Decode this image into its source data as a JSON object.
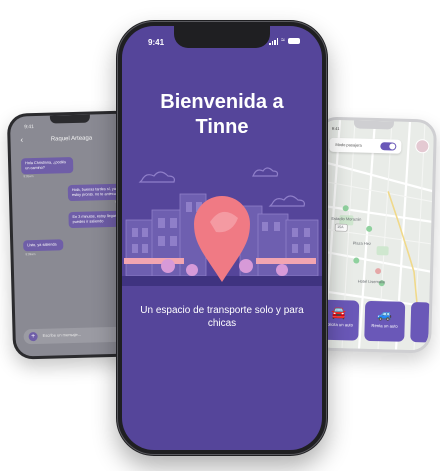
{
  "chat_phone": {
    "status_time": "9:41",
    "contact_name": "Raquel Arteaga",
    "messages": [
      {
        "direction": "in",
        "text": "Hola Christinna, ¿podés un camino?",
        "time": "9:05am"
      },
      {
        "direction": "out",
        "text": "Hola, buenas tardes sí, ya estoy pronto. no te antecupaj",
        "time": "9:06 am"
      },
      {
        "direction": "out",
        "text": "En 3 minutos, estoy llegando. puedes ir saliendo",
        "time": "9:07 am"
      },
      {
        "direction": "in",
        "text": "Listo, ya salienda",
        "time": "9:09am"
      }
    ],
    "input_placeholder": "Escribe un mensaje..."
  },
  "main_phone": {
    "status_time": "9:41",
    "title_line1": "Bienvenida a",
    "title_line2": "Tinne",
    "tagline": "Un espacio  de transporte solo  y para chicas",
    "colors": {
      "background": "#55459a",
      "pin": "#f07a84",
      "accent": "#8f7fc9"
    }
  },
  "map_phone": {
    "status_time": "9:41",
    "toggle_label": "Modo pasajera",
    "toggle_on": true,
    "map_labels": [
      "Estadio Morazán",
      "Plaza Hez",
      "Hotel Lisemalie"
    ],
    "route_badge": "15A",
    "actions": [
      {
        "label": "Solicita un auto",
        "icon": "car-icon"
      },
      {
        "label": "Renta un auto",
        "icon": "rent-car-icon"
      }
    ]
  }
}
